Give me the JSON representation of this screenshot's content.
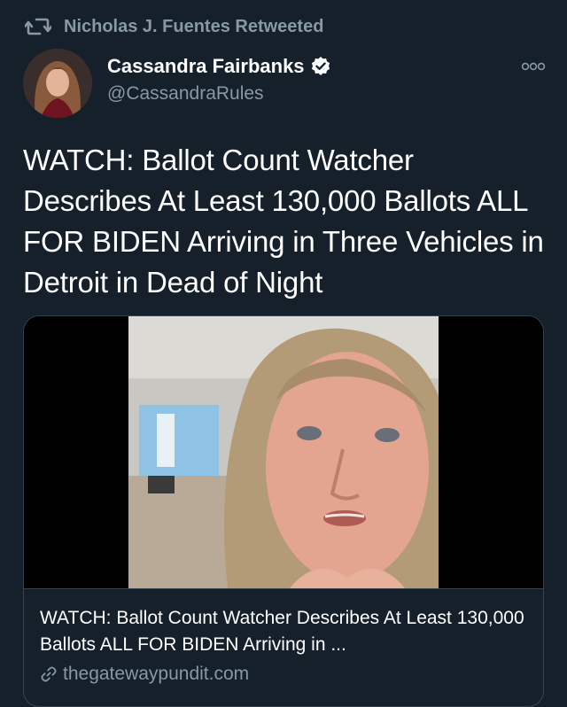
{
  "social_context": {
    "text": "Nicholas J. Fuentes Retweeted",
    "icon": "retweet-icon"
  },
  "author": {
    "name": "Cassandra Fairbanks",
    "handle": "@CassandraRules",
    "verified": true,
    "verified_color": "#ffffff"
  },
  "tweet": {
    "text": "WATCH: Ballot Count Watcher Describes At Least 130,000 Ballots ALL FOR BIDEN Arriving in Three Vehicles in Detroit in Dead of Night"
  },
  "card": {
    "title": "WATCH: Ballot Count Watcher Describes At Least 130,000 Ballots ALL FOR BIDEN Arriving in ...",
    "domain": "thegatewaypundit.com",
    "domain_icon": "link-icon"
  },
  "colors": {
    "background": "#15202b",
    "secondary_text": "#8899a6",
    "border": "#38444d"
  }
}
